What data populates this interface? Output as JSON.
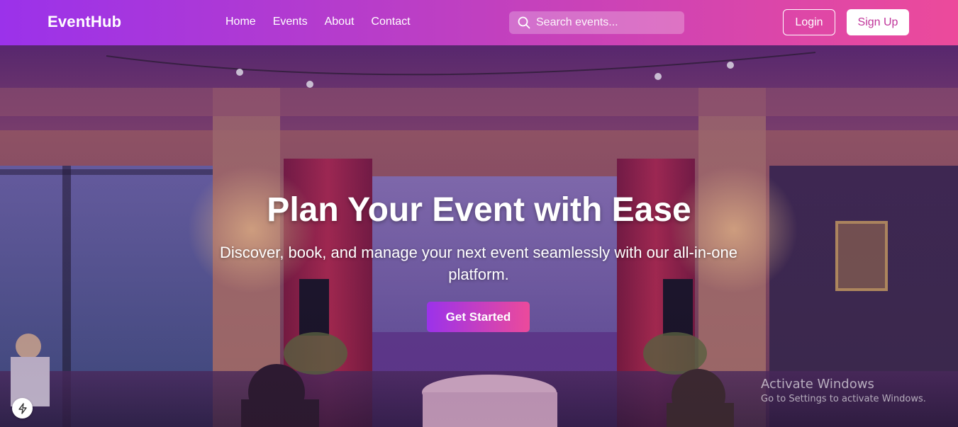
{
  "nav": {
    "brand": "EventHub",
    "links": [
      {
        "label": "Home"
      },
      {
        "label": "Events"
      },
      {
        "label": "About"
      },
      {
        "label": "Contact"
      }
    ],
    "search_placeholder": "Search events...",
    "login_label": "Login",
    "signup_label": "Sign Up"
  },
  "hero": {
    "title": "Plan Your Event with Ease",
    "subtitle": "Discover, book, and manage your next event seamlessly with our all-in-one platform.",
    "cta_label": "Get Started"
  },
  "watermark": {
    "title": "Activate Windows",
    "subtitle": "Go to Settings to activate Windows."
  },
  "icons": {
    "search": "search-icon",
    "bolt": "lightning-bolt-icon"
  },
  "colors": {
    "gradient_start": "#9b32ea",
    "gradient_end": "#ec4a9b",
    "signup_text": "#c0359a"
  }
}
